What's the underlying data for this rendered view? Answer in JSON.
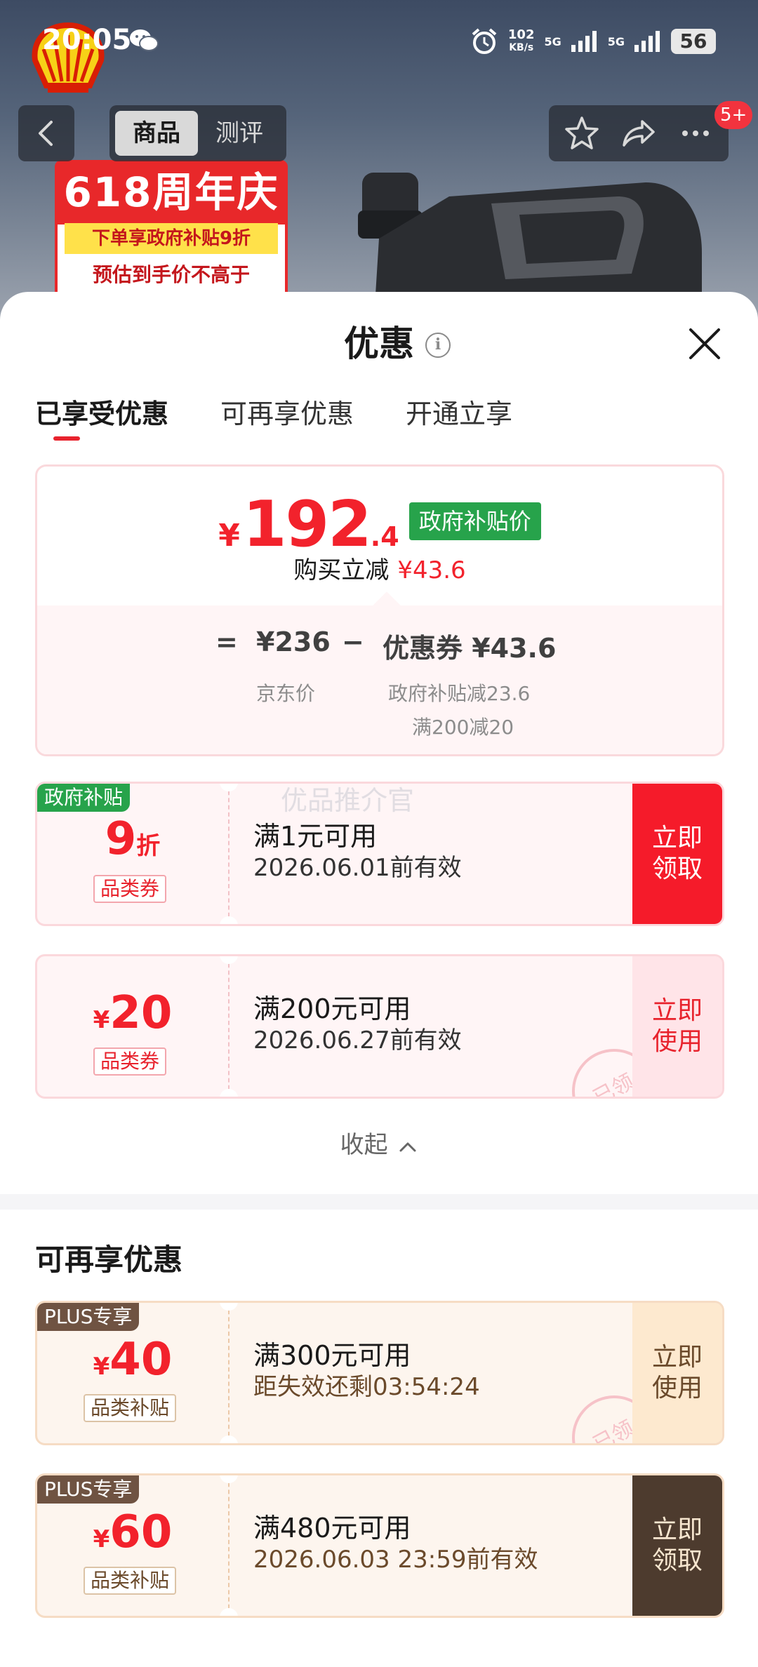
{
  "status_bar": {
    "time": "20:05",
    "network_speed_value": "102",
    "network_speed_unit": "KB/s",
    "signal1": "5G",
    "signal2": "5G",
    "battery": "56"
  },
  "nav": {
    "tabs": [
      {
        "label": "商品",
        "active": true
      },
      {
        "label": "测评",
        "active": false
      }
    ],
    "badge": "5+"
  },
  "product_banner": {
    "headline": "618周年庆",
    "line1": "下单享政府补贴9折",
    "line2": "预估到手价不高于"
  },
  "sheet": {
    "title": "优惠",
    "tabs": [
      {
        "label": "已享受优惠",
        "active": true
      },
      {
        "label": "可再享优惠",
        "active": false
      },
      {
        "label": "开通立享",
        "active": false
      }
    ]
  },
  "summary": {
    "currency": "¥",
    "price_int": "192",
    "price_dec": ".4",
    "price_tag": "政府补贴价",
    "reduce_label": "购买立减",
    "reduce_amount": "¥43.6",
    "eq": "=",
    "jd_price": "¥236",
    "jd_label": "京东价",
    "minus": "−",
    "coupon_total": "优惠券 ¥43.6",
    "coupon_detail1": "政府补贴减23.6",
    "coupon_detail2": "满200减20"
  },
  "watermark": "优品推介官",
  "used_coupons": [
    {
      "corner": "政府补贴",
      "amount_big": "9",
      "amount_small": "折",
      "type": "品类券",
      "condition": "满1元可用",
      "date": "2026.06.01前有效",
      "button": [
        "立即",
        "领取"
      ]
    },
    {
      "amount_prefix": "¥",
      "amount_big": "20",
      "type": "品类券",
      "condition": "满200元可用",
      "date": "2026.06.27前有效",
      "button": [
        "立即",
        "使用"
      ],
      "stamp": "已领"
    }
  ],
  "collapse_label": "收起",
  "more_section_title": "可再享优惠",
  "more_coupons": [
    {
      "corner": "PLUS专享",
      "amount_prefix": "¥",
      "amount_big": "40",
      "type": "品类补贴",
      "condition": "满300元可用",
      "date": "距失效还剩03:54:24",
      "button": [
        "立即",
        "使用"
      ],
      "stamp": "已领"
    },
    {
      "corner": "PLUS专享",
      "amount_prefix": "¥",
      "amount_big": "60",
      "type": "品类补贴",
      "condition": "满480元可用",
      "date": "2026.06.03 23:59前有效",
      "button": [
        "立即",
        "领取"
      ]
    }
  ],
  "colors": {
    "accent_red": "#f2222c",
    "gov_green": "#27a34b",
    "plus_brown": "#6f5342"
  }
}
